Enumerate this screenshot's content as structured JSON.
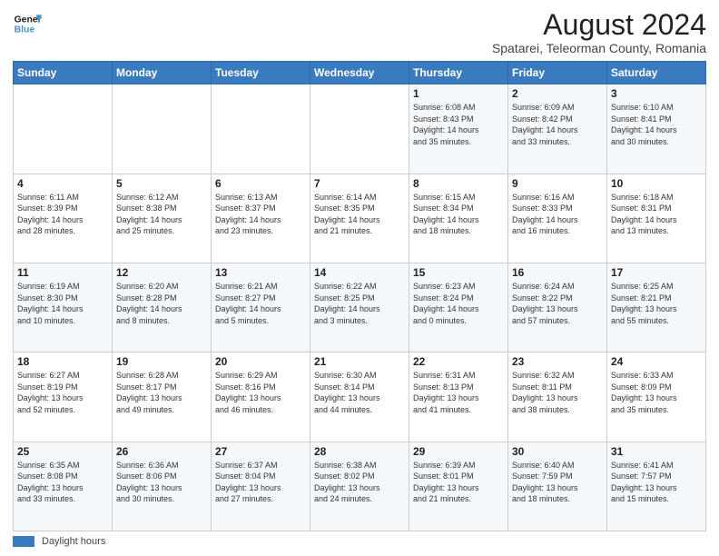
{
  "header": {
    "logo_line1": "General",
    "logo_line2": "Blue",
    "main_title": "August 2024",
    "subtitle": "Spatarei, Teleorman County, Romania"
  },
  "calendar": {
    "days_of_week": [
      "Sunday",
      "Monday",
      "Tuesday",
      "Wednesday",
      "Thursday",
      "Friday",
      "Saturday"
    ],
    "weeks": [
      [
        {
          "day": "",
          "info": ""
        },
        {
          "day": "",
          "info": ""
        },
        {
          "day": "",
          "info": ""
        },
        {
          "day": "",
          "info": ""
        },
        {
          "day": "1",
          "info": "Sunrise: 6:08 AM\nSunset: 8:43 PM\nDaylight: 14 hours\nand 35 minutes."
        },
        {
          "day": "2",
          "info": "Sunrise: 6:09 AM\nSunset: 8:42 PM\nDaylight: 14 hours\nand 33 minutes."
        },
        {
          "day": "3",
          "info": "Sunrise: 6:10 AM\nSunset: 8:41 PM\nDaylight: 14 hours\nand 30 minutes."
        }
      ],
      [
        {
          "day": "4",
          "info": "Sunrise: 6:11 AM\nSunset: 8:39 PM\nDaylight: 14 hours\nand 28 minutes."
        },
        {
          "day": "5",
          "info": "Sunrise: 6:12 AM\nSunset: 8:38 PM\nDaylight: 14 hours\nand 25 minutes."
        },
        {
          "day": "6",
          "info": "Sunrise: 6:13 AM\nSunset: 8:37 PM\nDaylight: 14 hours\nand 23 minutes."
        },
        {
          "day": "7",
          "info": "Sunrise: 6:14 AM\nSunset: 8:35 PM\nDaylight: 14 hours\nand 21 minutes."
        },
        {
          "day": "8",
          "info": "Sunrise: 6:15 AM\nSunset: 8:34 PM\nDaylight: 14 hours\nand 18 minutes."
        },
        {
          "day": "9",
          "info": "Sunrise: 6:16 AM\nSunset: 8:33 PM\nDaylight: 14 hours\nand 16 minutes."
        },
        {
          "day": "10",
          "info": "Sunrise: 6:18 AM\nSunset: 8:31 PM\nDaylight: 14 hours\nand 13 minutes."
        }
      ],
      [
        {
          "day": "11",
          "info": "Sunrise: 6:19 AM\nSunset: 8:30 PM\nDaylight: 14 hours\nand 10 minutes."
        },
        {
          "day": "12",
          "info": "Sunrise: 6:20 AM\nSunset: 8:28 PM\nDaylight: 14 hours\nand 8 minutes."
        },
        {
          "day": "13",
          "info": "Sunrise: 6:21 AM\nSunset: 8:27 PM\nDaylight: 14 hours\nand 5 minutes."
        },
        {
          "day": "14",
          "info": "Sunrise: 6:22 AM\nSunset: 8:25 PM\nDaylight: 14 hours\nand 3 minutes."
        },
        {
          "day": "15",
          "info": "Sunrise: 6:23 AM\nSunset: 8:24 PM\nDaylight: 14 hours\nand 0 minutes."
        },
        {
          "day": "16",
          "info": "Sunrise: 6:24 AM\nSunset: 8:22 PM\nDaylight: 13 hours\nand 57 minutes."
        },
        {
          "day": "17",
          "info": "Sunrise: 6:25 AM\nSunset: 8:21 PM\nDaylight: 13 hours\nand 55 minutes."
        }
      ],
      [
        {
          "day": "18",
          "info": "Sunrise: 6:27 AM\nSunset: 8:19 PM\nDaylight: 13 hours\nand 52 minutes."
        },
        {
          "day": "19",
          "info": "Sunrise: 6:28 AM\nSunset: 8:17 PM\nDaylight: 13 hours\nand 49 minutes."
        },
        {
          "day": "20",
          "info": "Sunrise: 6:29 AM\nSunset: 8:16 PM\nDaylight: 13 hours\nand 46 minutes."
        },
        {
          "day": "21",
          "info": "Sunrise: 6:30 AM\nSunset: 8:14 PM\nDaylight: 13 hours\nand 44 minutes."
        },
        {
          "day": "22",
          "info": "Sunrise: 6:31 AM\nSunset: 8:13 PM\nDaylight: 13 hours\nand 41 minutes."
        },
        {
          "day": "23",
          "info": "Sunrise: 6:32 AM\nSunset: 8:11 PM\nDaylight: 13 hours\nand 38 minutes."
        },
        {
          "day": "24",
          "info": "Sunrise: 6:33 AM\nSunset: 8:09 PM\nDaylight: 13 hours\nand 35 minutes."
        }
      ],
      [
        {
          "day": "25",
          "info": "Sunrise: 6:35 AM\nSunset: 8:08 PM\nDaylight: 13 hours\nand 33 minutes."
        },
        {
          "day": "26",
          "info": "Sunrise: 6:36 AM\nSunset: 8:06 PM\nDaylight: 13 hours\nand 30 minutes."
        },
        {
          "day": "27",
          "info": "Sunrise: 6:37 AM\nSunset: 8:04 PM\nDaylight: 13 hours\nand 27 minutes."
        },
        {
          "day": "28",
          "info": "Sunrise: 6:38 AM\nSunset: 8:02 PM\nDaylight: 13 hours\nand 24 minutes."
        },
        {
          "day": "29",
          "info": "Sunrise: 6:39 AM\nSunset: 8:01 PM\nDaylight: 13 hours\nand 21 minutes."
        },
        {
          "day": "30",
          "info": "Sunrise: 6:40 AM\nSunset: 7:59 PM\nDaylight: 13 hours\nand 18 minutes."
        },
        {
          "day": "31",
          "info": "Sunrise: 6:41 AM\nSunset: 7:57 PM\nDaylight: 13 hours\nand 15 minutes."
        }
      ]
    ]
  },
  "legend": {
    "label": "Daylight hours"
  }
}
